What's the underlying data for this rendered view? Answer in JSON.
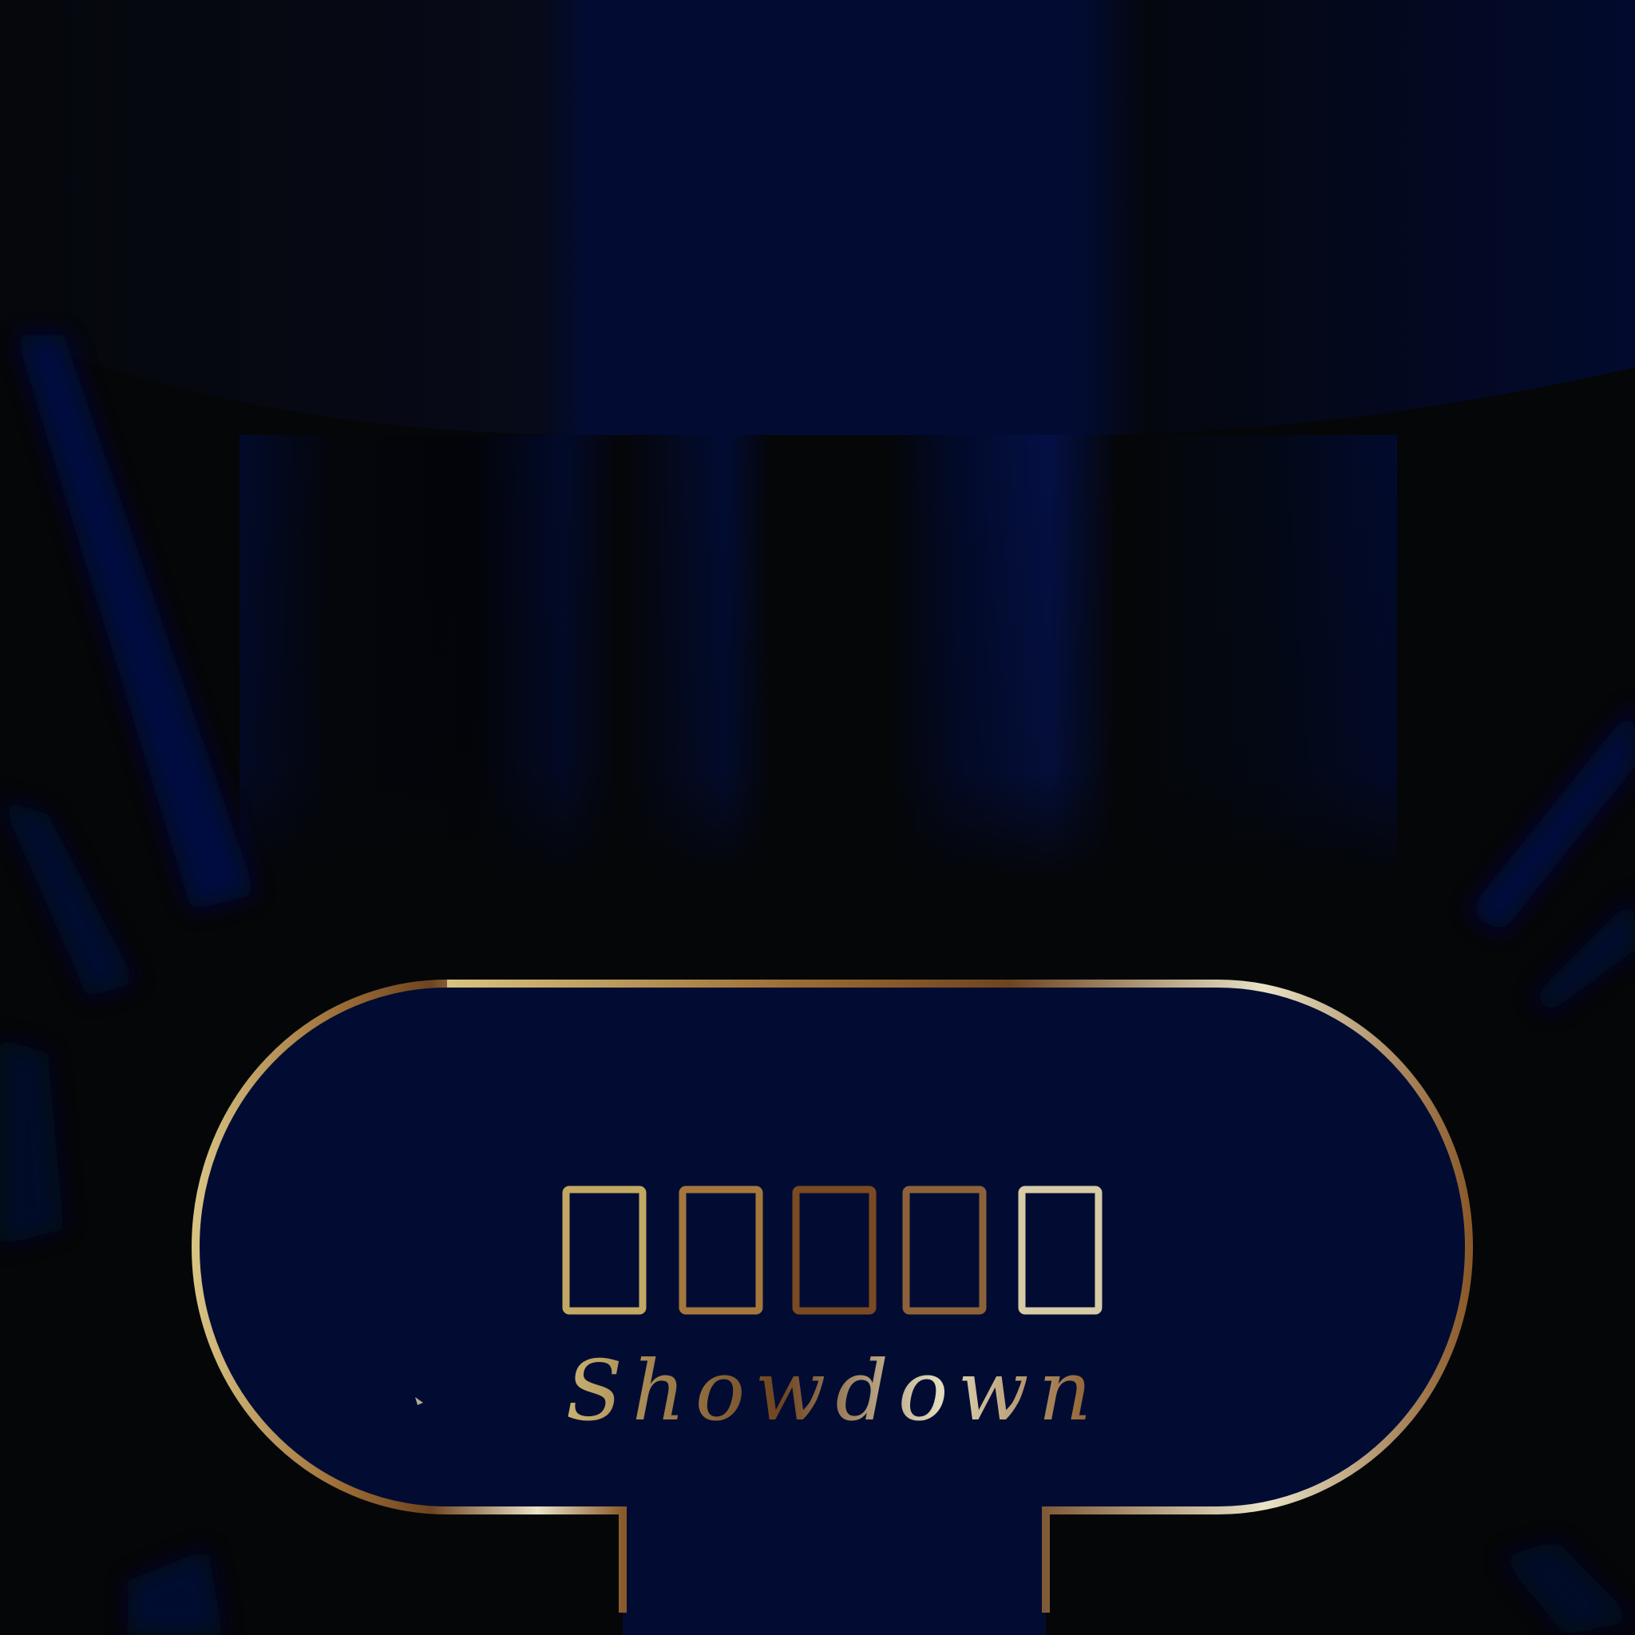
{
  "screen": {
    "name": "title-screen"
  },
  "title": {
    "subtitle": "Showdown",
    "glyph_count": 5
  },
  "colors": {
    "background": "#050608",
    "navy": "#020c33",
    "navy_light": "#04124a",
    "gold_light": "#d8c383",
    "gold_dark": "#6e4420",
    "gold_pale": "#e9e3c8"
  }
}
